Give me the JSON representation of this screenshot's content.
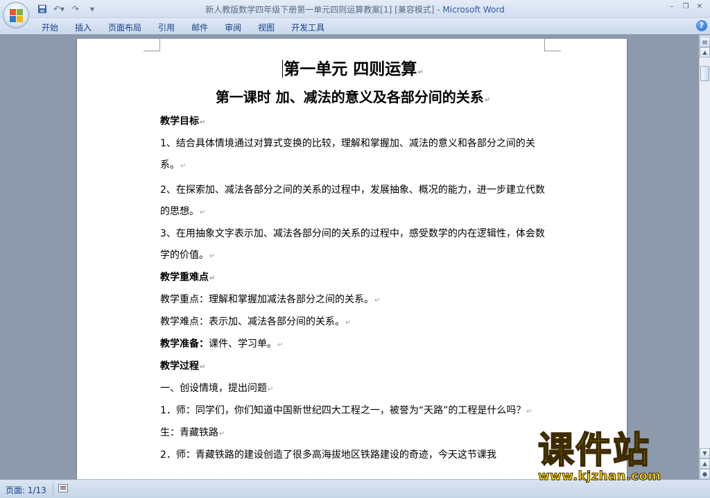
{
  "window": {
    "title": "新人教版数学四年级下册第一单元四则运算教案[1] [兼容模式] - ",
    "app_name": "Microsoft Word"
  },
  "qat": {
    "save_icon": "save-icon",
    "undo_icon": "undo-icon",
    "redo_icon": "redo-icon",
    "customize_icon": "customize-qat-icon"
  },
  "ribbon": {
    "tabs": [
      "开始",
      "插入",
      "页面布局",
      "引用",
      "邮件",
      "审阅",
      "视图",
      "开发工具"
    ],
    "help": "?"
  },
  "document": {
    "heading1": "第一单元  四则运算",
    "heading2": "第一课时  加、减法的意义及各部分间的关系",
    "pilcrow": "↵",
    "sections": {
      "goals_title": "教学目标",
      "goal1": "1、结合具体情境通过对算式变换的比较，理解和掌握加、减法的意义和各部分之间的关系。",
      "goal2": "2、在探索加、减法各部分之间的关系的过程中，发展抽象、概况的能力，进一步建立代数的思想。",
      "goal3": "3、在用抽象文字表示加、减法各部分间的关系的过程中，感受数学的内在逻辑性，体会数学的价值。",
      "key_title": "教学重难点",
      "key_point": "教学重点：理解和掌握加减法各部分之间的关系。",
      "difficult_point": "教学难点：表示加、减法各部分间的关系。",
      "prep_label": "教学准备：",
      "prep_value": "课件、学习单。",
      "process_title": "教学过程",
      "step1": "一、创设情境，提出问题",
      "line1": "1．师：同学们，你们知道中国新世纪四大工程之一，被誉为“天路”的工程是什么吗？",
      "line2": "生：青藏铁路",
      "line3": "2．师：青藏铁路的建设创造了很多高海拔地区铁路建设的奇迹，今天这节课我"
    }
  },
  "statusbar": {
    "page": "页面: 1/13"
  },
  "watermark": {
    "title": "课件站",
    "url": "www.kjzhan.com"
  }
}
